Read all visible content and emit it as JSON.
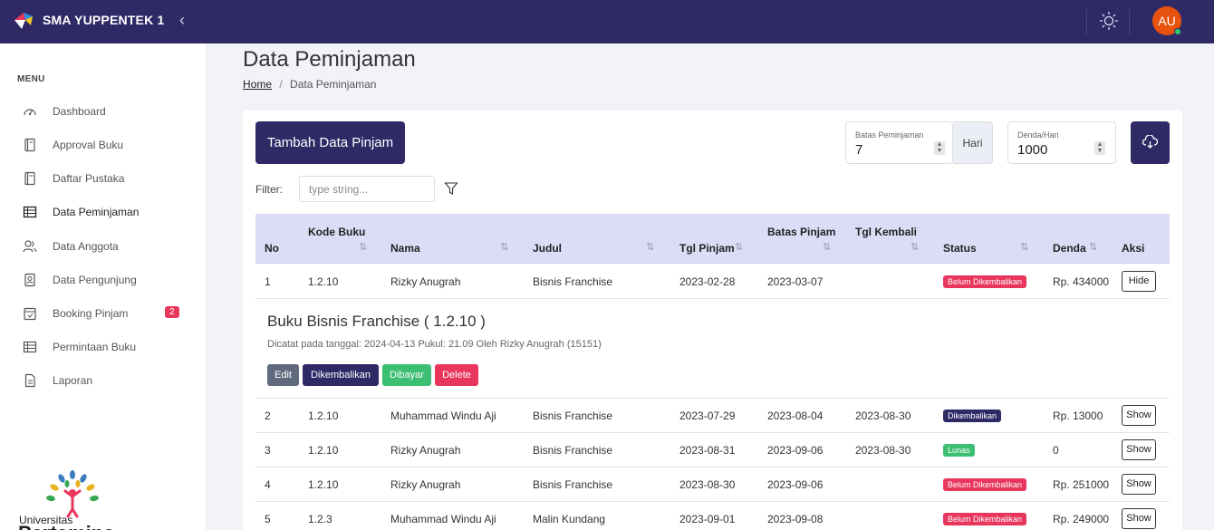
{
  "header": {
    "brand": "SMA YUPPENTEK 1",
    "avatar": "AU"
  },
  "sidebar": {
    "menu_title": "MENU",
    "items": [
      {
        "label": "Dashboard",
        "icon": "gauge-icon"
      },
      {
        "label": "Approval Buku",
        "icon": "book-icon"
      },
      {
        "label": "Daftar Pustaka",
        "icon": "book-icon"
      },
      {
        "label": "Data Peminjaman",
        "icon": "table-icon"
      },
      {
        "label": "Data Anggota",
        "icon": "users-icon"
      },
      {
        "label": "Data Pengunjung",
        "icon": "contact-book-icon"
      },
      {
        "label": "Booking Pinjam",
        "icon": "calendar-icon",
        "badge": "2"
      },
      {
        "label": "Permintaan Buku",
        "icon": "table-icon"
      },
      {
        "label": "Laporan",
        "icon": "document-icon"
      }
    ],
    "footer_logo_text_1": "Universitas",
    "footer_logo_text_2": "Pertamina"
  },
  "page": {
    "title": "Data Peminjaman",
    "breadcrumb_home": "Home",
    "breadcrumb_sep": "/",
    "breadcrumb_current": "Data Peminjaman"
  },
  "toolbar": {
    "add_button": "Tambah Data Pinjam",
    "batas_label": "Batas Peminjaman",
    "batas_value": "7",
    "hari": "Hari",
    "denda_label": "Denda/Hari",
    "denda_value": "1000",
    "filter_label": "Filter:",
    "filter_placeholder": "type string..."
  },
  "table": {
    "headers": [
      "No",
      "Kode Buku",
      "Nama",
      "Judul",
      "Tgl Pinjam",
      "Batas Pinjam",
      "Tgl Kembali",
      "Status",
      "Denda",
      "Aksi"
    ],
    "rows": [
      {
        "no": "1",
        "kode": "1.2.10",
        "nama": "Rizky Anugrah",
        "judul": "Bisnis Franchise",
        "tgl_pinjam": "2023-02-28",
        "batas": "2023-03-07",
        "kembali": "",
        "status": "Belum Dikembalikan",
        "status_type": "belum",
        "denda": "Rp. 434000",
        "aksi": "Hide"
      },
      {
        "no": "2",
        "kode": "1.2.10",
        "nama": "Muhammad Windu Aji",
        "judul": "Bisnis Franchise",
        "tgl_pinjam": "2023-07-29",
        "batas": "2023-08-04",
        "kembali": "2023-08-30",
        "status": "Dikembalikan",
        "status_type": "kembali",
        "denda": "Rp. 13000",
        "aksi": "Show"
      },
      {
        "no": "3",
        "kode": "1.2.10",
        "nama": "Rizky Anugrah",
        "judul": "Bisnis Franchise",
        "tgl_pinjam": "2023-08-31",
        "batas": "2023-09-06",
        "kembali": "2023-08-30",
        "status": "Lunas",
        "status_type": "lunas",
        "denda": "0",
        "aksi": "Show"
      },
      {
        "no": "4",
        "kode": "1.2.10",
        "nama": "Rizky Anugrah",
        "judul": "Bisnis Franchise",
        "tgl_pinjam": "2023-08-30",
        "batas": "2023-09-06",
        "kembali": "",
        "status": "Belum Dikembalikan",
        "status_type": "belum",
        "denda": "Rp. 251000",
        "aksi": "Show"
      },
      {
        "no": "5",
        "kode": "1.2.3",
        "nama": "Muhammad Windu Aji",
        "judul": "Malin Kundang",
        "tgl_pinjam": "2023-09-01",
        "batas": "2023-09-08",
        "kembali": "",
        "status": "Belum Dikembalikan",
        "status_type": "belum",
        "denda": "Rp. 249000",
        "aksi": "Show"
      }
    ]
  },
  "detail": {
    "title": "Buku Bisnis Franchise ( 1.2.10 )",
    "meta": "Dicatat pada tanggal: 2024-04-13 Pukul: 21.09 Oleh Rizky Anugrah (15151)",
    "buttons": [
      "Edit",
      "Dikembalikan",
      "Dibayar",
      "Delete"
    ]
  },
  "colors": {
    "primary": "#2f2a66",
    "danger": "#e8365d",
    "success": "#3dbf73",
    "header_row": "#dcdcf7"
  }
}
